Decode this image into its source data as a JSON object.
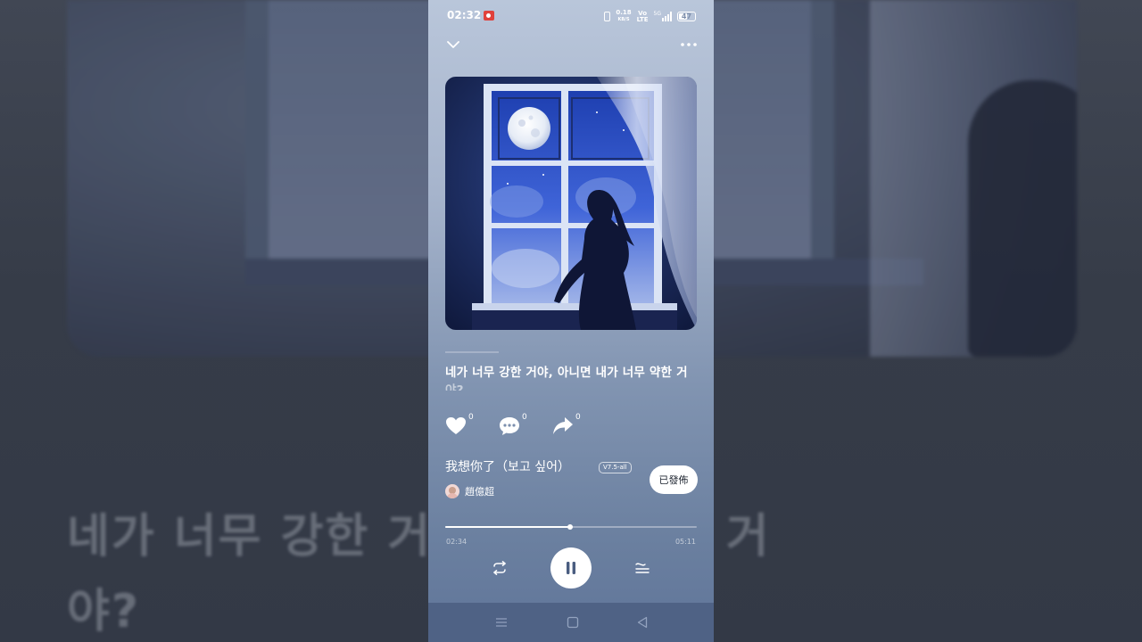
{
  "status_bar": {
    "time": "02:32",
    "net_speed": "0.18",
    "net_speed_unit": "KB/S",
    "volte_top": "Vo",
    "volte_bottom": "LTE",
    "network": "5G",
    "battery": "47"
  },
  "header": {
    "collapse_icon": "chevron-down-icon",
    "more_icon": "more-icon"
  },
  "lyrics": {
    "current_line_1": "네가 너무 강한 거야, 아니면 내가 너무 약한 거",
    "current_line_2": "야?",
    "background_line_1": "네가 너무 강한 거                    가 너무 약한 거",
    "background_line_2": "야?"
  },
  "actions": {
    "like_count": "0",
    "comment_count": "0",
    "share_count": "0"
  },
  "song": {
    "title": "我想你了（보고 싶어）",
    "version_badge": "V7.5-all",
    "artist": "趙億超",
    "publish_label": "已發佈"
  },
  "playback": {
    "current_time": "02:34",
    "duration": "05:11",
    "progress": 0.495,
    "state": "playing"
  },
  "colors": {
    "accent": "#ffffff",
    "card_gradient_top": "#b9c6da",
    "card_gradient_bottom": "#60759a",
    "record_indicator": "#e0413b"
  }
}
